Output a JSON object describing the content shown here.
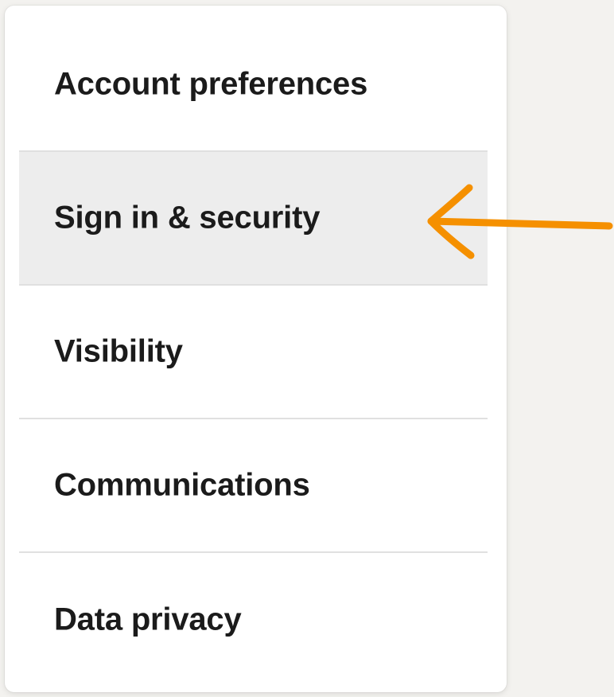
{
  "settings_menu": {
    "items": [
      {
        "label": "Account preferences",
        "selected": false
      },
      {
        "label": "Sign in & security",
        "selected": true
      },
      {
        "label": "Visibility",
        "selected": false
      },
      {
        "label": "Communications",
        "selected": false
      },
      {
        "label": "Data privacy",
        "selected": false
      }
    ]
  },
  "annotation": {
    "arrow_icon": "arrow-left-icon",
    "arrow_color": "#f59000",
    "points_to": "Sign in & security"
  },
  "colors": {
    "selected_background": "#ededed",
    "divider": "#e0e0e0",
    "text": "#1b1b1b",
    "card_background": "#ffffff"
  }
}
